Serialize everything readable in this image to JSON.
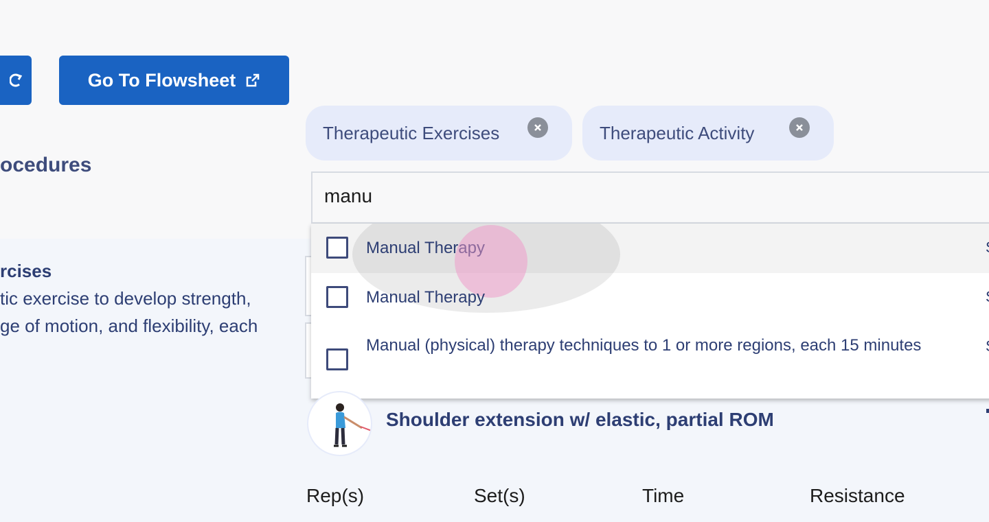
{
  "toolbar": {
    "refresh_icon": "refresh-icon",
    "flowsheet_label": "Go To Flowsheet",
    "flowsheet_icon": "external-link-icon"
  },
  "section": {
    "title_partial": "ocedures"
  },
  "chips": [
    {
      "label": "Therapeutic Exercises",
      "icon": "close-circle-icon"
    },
    {
      "label": "Therapeutic Activity",
      "icon": "close-circle-icon"
    }
  ],
  "search": {
    "value": "manu"
  },
  "dropdown": {
    "options": [
      {
        "label": "Manual Therapy",
        "side": "S"
      },
      {
        "label": "Manual Therapy",
        "side": "S"
      },
      {
        "label": "Manual (physical) therapy techniques to 1 or more regions, each 15 minutes",
        "side": "S"
      }
    ]
  },
  "exercise_group": {
    "title_partial": "rcises",
    "desc_line1": "tic exercise to develop strength,",
    "desc_line2": "ge of motion, and flexibility, each"
  },
  "exercise": {
    "name": "Shoulder extension w/ elastic, partial ROM",
    "image_icon": "person-exercise-figure"
  },
  "columns": [
    "Rep(s)",
    "Set(s)",
    "Time",
    "Resistance"
  ],
  "colors": {
    "primary": "#1a63c2",
    "chip_bg": "#e6ebfa",
    "text_dark": "#2d3e73",
    "panel_bg": "#f3f6fb"
  }
}
